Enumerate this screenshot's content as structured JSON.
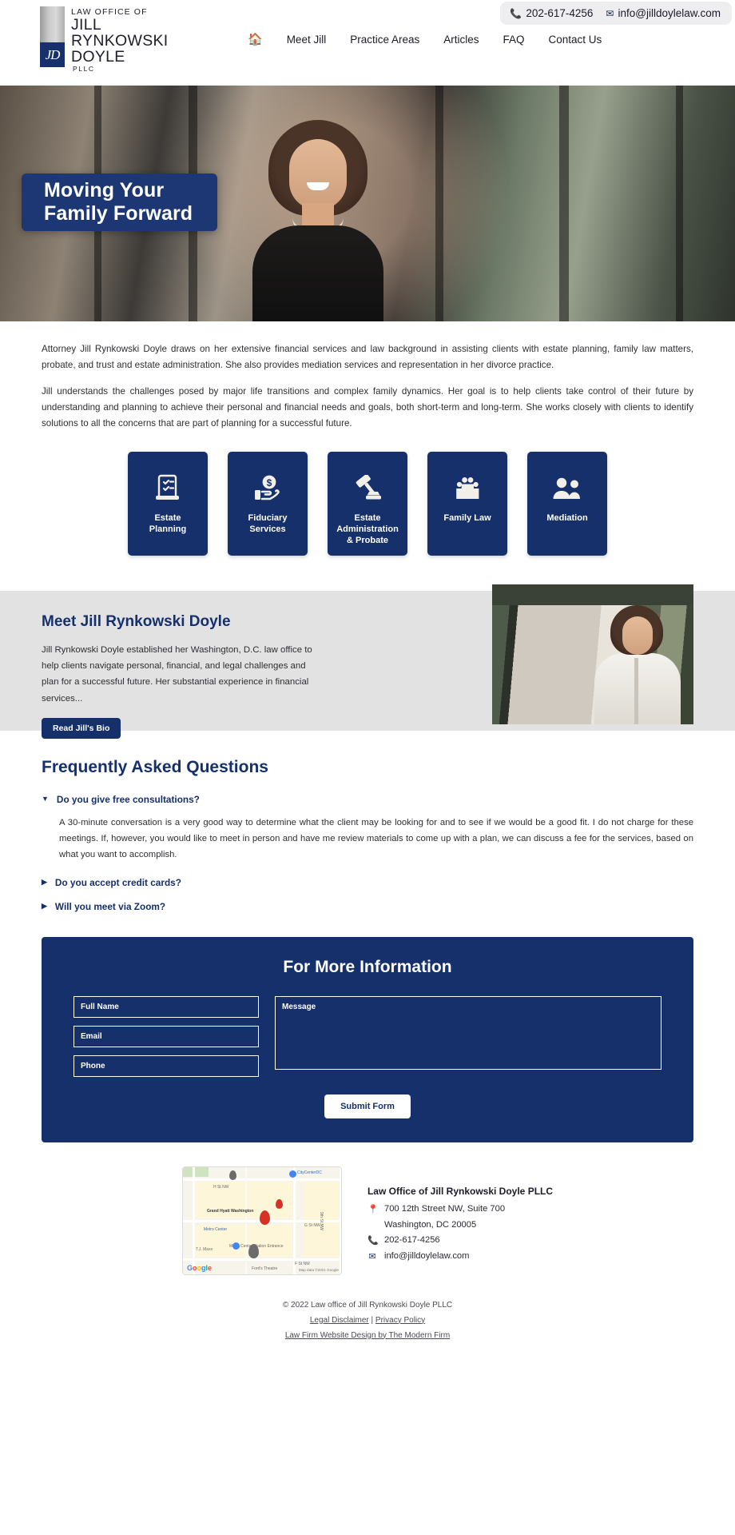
{
  "brand": {
    "line1": "LAW OFFICE OF",
    "line2": "JILL",
    "line3": "RYNKOWSKI",
    "line4": "DOYLE",
    "line5": "PLLC",
    "badge_initials": "JD",
    "accent_color": "#16306c"
  },
  "topbar": {
    "phone": "202-617-4256",
    "email": "info@jilldoylelaw.com",
    "phone_icon": "phone-icon",
    "email_icon": "envelope-icon"
  },
  "nav": {
    "home_icon": "home-icon",
    "items": [
      {
        "label": "Meet Jill"
      },
      {
        "label": "Practice Areas"
      },
      {
        "label": "Articles"
      },
      {
        "label": "FAQ"
      },
      {
        "label": "Contact Us"
      }
    ]
  },
  "hero": {
    "headline_line1": "Moving Your",
    "headline_line2": "Family Forward"
  },
  "intro": {
    "paragraph1": "Attorney Jill Rynkowski Doyle draws on her extensive financial services and law background in assisting clients with estate planning, family law matters, probate, and trust and estate administration. She also provides mediation services and representation in her divorce practice.",
    "paragraph2": "Jill understands the challenges posed by major life transitions and complex family dynamics. Her goal is to help clients take control of their future by understanding and planning to achieve their personal and financial needs and goals, both short-term and long-term. She works closely with clients to identify solutions to all the concerns that are part of planning for a successful future."
  },
  "practice_cards": [
    {
      "label": "Estate\nPlanning",
      "icon": "document-checklist-icon"
    },
    {
      "label": "Fiduciary\nServices",
      "icon": "hand-coin-icon"
    },
    {
      "label": "Estate\nAdministration\n& Probate",
      "icon": "gavel-icon"
    },
    {
      "label": "Family Law",
      "icon": "family-group-icon"
    },
    {
      "label": "Mediation",
      "icon": "two-people-icon"
    }
  ],
  "meet": {
    "heading": "Meet Jill Rynkowski Doyle",
    "body": "Jill Rynkowski Doyle established her Washington, D.C. law office to help clients navigate personal, financial, and legal challenges and plan for a successful future. Her substantial experience in financial services...",
    "button_label": "Read Jill's Bio"
  },
  "faq": {
    "heading": "Frequently Asked Questions",
    "items": [
      {
        "question": "Do you give free consultations?",
        "expanded_marker": "▼",
        "answer": "A 30-minute conversation is a very good way to determine what the client may be looking for and to see if we would be a good fit. I do not charge for these meetings. If, however, you would like to meet in person and have me review materials to come up with a plan, we can discuss a fee for the services, based on what you want to accomplish."
      },
      {
        "question": "Do you accept credit cards?",
        "expanded_marker": "▶",
        "answer": ""
      },
      {
        "question": "Will you meet via Zoom?",
        "expanded_marker": "▶",
        "answer": ""
      }
    ]
  },
  "form": {
    "heading": "For More Information",
    "full_name_placeholder": "Full Name",
    "email_placeholder": "Email",
    "phone_placeholder": "Phone",
    "message_placeholder": "Message",
    "submit_label": "Submit Form"
  },
  "map": {
    "labels": [
      "CityCenterDC",
      "H St NW",
      "Grand Hyatt Washington",
      "Metro Center",
      "T.J. Maxx",
      "Metro Center Station Entrance",
      "Ford's Theatre",
      "G St NW",
      "F St NW",
      "9th St NW",
      "10th St NW"
    ],
    "logo_text": "Google",
    "attribution": "Map data ©2021 Google"
  },
  "address": {
    "firm": "Law Office of Jill Rynkowski Doyle PLLC",
    "street": "700 12th Street NW, Suite 700",
    "city": "Washington, DC 20005",
    "phone": "202-617-4256",
    "email": "info@jilldoylelaw.com",
    "pin_icon": "location-pin-icon",
    "phone_icon": "phone-icon",
    "email_icon": "envelope-icon"
  },
  "footer": {
    "copyright": "© 2022 Law office of Jill Rynkowski Doyle PLLC",
    "legal_disclaimer": "Legal Disclaimer",
    "separator": "|",
    "privacy_policy": "Privacy Policy",
    "credit": "Law Firm Website Design by The Modern Firm"
  }
}
